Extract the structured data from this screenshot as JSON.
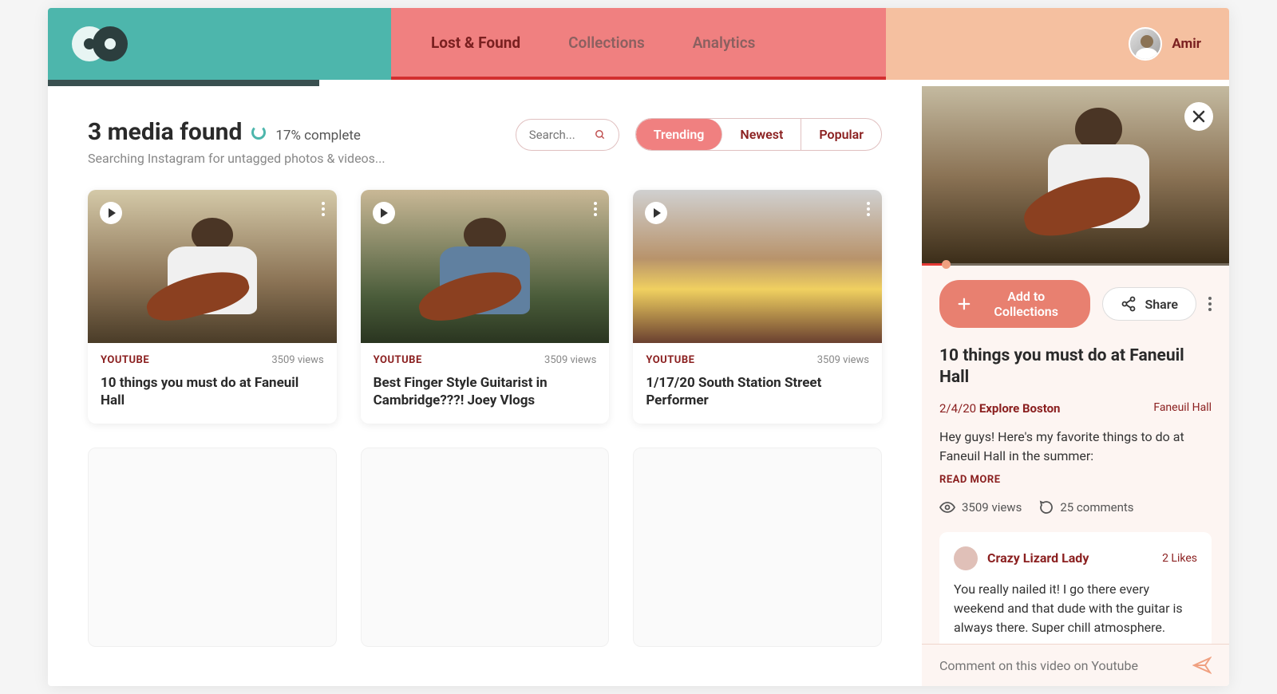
{
  "header": {
    "nav": [
      {
        "label": "Lost & Found",
        "active": true
      },
      {
        "label": "Collections",
        "active": false
      },
      {
        "label": "Analytics",
        "active": false
      }
    ],
    "username": "Amir"
  },
  "main": {
    "title": "3 media found",
    "percent_complete": "17% complete",
    "subtitle": "Searching Instagram for untagged photos & videos...",
    "search_placeholder": "Search...",
    "filters": [
      {
        "label": "Trending",
        "active": true
      },
      {
        "label": "Newest",
        "active": false
      },
      {
        "label": "Popular",
        "active": false
      }
    ],
    "cards": [
      {
        "platform": "YOUTUBE",
        "views": "3509 views",
        "title": "10 things you must do at Faneuil Hall"
      },
      {
        "platform": "YOUTUBE",
        "views": "3509 views",
        "title": "Best Finger Style Guitarist in Cambridge???! Joey Vlogs"
      },
      {
        "platform": "YOUTUBE",
        "views": "3509 views",
        "title": "1/17/20 South Station Street Performer"
      }
    ]
  },
  "detail": {
    "add_label": "Add to Collections",
    "share_label": "Share",
    "title": "10 things you must do at Faneuil Hall",
    "date": "2/4/20",
    "channel": "Explore Boston",
    "location": "Faneuil Hall",
    "description": "Hey guys! Here's my favorite things to do at Faneuil Hall in the summer:",
    "read_more": "READ MORE",
    "stats": {
      "views": "3509 views",
      "comments": "25 comments"
    },
    "comment": {
      "author": "Crazy Lizard Lady",
      "likes": "2 Likes",
      "text": "You really nailed it! I go there every weekend and that dude with the guitar is always there. Super chill atmosphere."
    },
    "comment_placeholder": "Comment on this video on Youtube"
  }
}
